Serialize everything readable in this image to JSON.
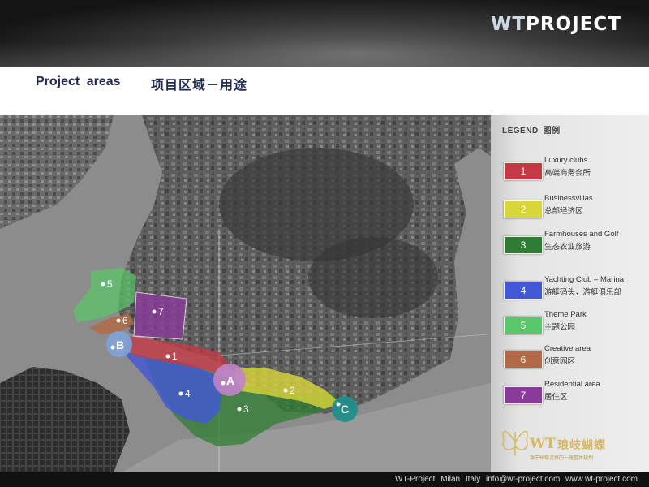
{
  "header": {
    "brand_prefix": "WT",
    "brand_suffix": "PROJECT"
  },
  "title": {
    "en": "Project  areas",
    "zh": "项目区域－用途"
  },
  "legend": {
    "title": "LEGEND",
    "title_zh": "图例",
    "items": [
      {
        "num": "1",
        "color": "#c23a44",
        "en": "Luxury clubs",
        "zh": "高端商务会所"
      },
      {
        "num": "2",
        "color": "#d9d63a",
        "en": "Businessvillas",
        "zh": "总部经济区"
      },
      {
        "num": "3",
        "color": "#2f7d32",
        "en": "Farmhouses and Golf",
        "zh": "生态农业旅游"
      },
      {
        "num": "4",
        "color": "#4256d6",
        "en": "Yachting Club – Marina",
        "zh": "游艇码头，游艇俱乐部"
      },
      {
        "num": "5",
        "color": "#5ac86a",
        "en": "Theme Park",
        "zh": "主题公园"
      },
      {
        "num": "6",
        "color": "#b06a48",
        "en": "Creative area",
        "zh": "创意园区"
      },
      {
        "num": "7",
        "color": "#8a3a9a",
        "en": "Residential area",
        "zh": "居住区"
      }
    ]
  },
  "map": {
    "area_labels": [
      "1",
      "2",
      "3",
      "4",
      "5",
      "6",
      "7"
    ],
    "circles": [
      {
        "label": "A",
        "color": "#c283c9"
      },
      {
        "label": "B",
        "color": "#7fa3d9"
      },
      {
        "label": "C",
        "color": "#1f8f8a"
      }
    ]
  },
  "logo": {
    "wt": "WT",
    "cn": "琅岐蝴蝶",
    "tag": "源于蝴蝶灵感的一座整体规划"
  },
  "footer": {
    "text": "WT-Project   Milan   Italy   info@wt-project.com   www.wt-project.com"
  }
}
